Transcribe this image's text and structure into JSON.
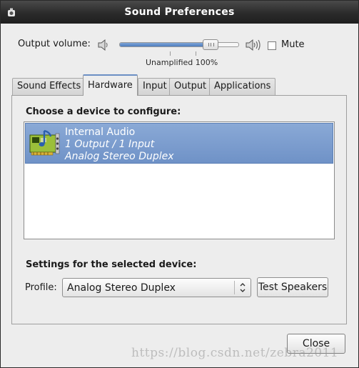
{
  "window": {
    "title": "Sound Preferences"
  },
  "volume": {
    "label": "Output volume:",
    "level_fraction": 0.77,
    "marker_label": "Unamplified 100%",
    "mute_label": "Mute",
    "mute_checked": false
  },
  "tabs": [
    {
      "label": "Sound Effects",
      "active": false
    },
    {
      "label": "Hardware",
      "active": true
    },
    {
      "label": "Input",
      "active": false
    },
    {
      "label": "Output",
      "active": false
    },
    {
      "label": "Applications",
      "active": false
    }
  ],
  "hardware": {
    "choose_label": "Choose a device to configure:",
    "devices": [
      {
        "name": "Internal Audio",
        "io": "1 Output / 1 Input",
        "profile": "Analog Stereo Duplex",
        "selected": true
      }
    ],
    "settings_label": "Settings for the selected device:",
    "profile_label": "Profile:",
    "profile_value": "Analog Stereo Duplex",
    "test_button": "Test Speakers"
  },
  "footer": {
    "close_button": "Close"
  },
  "watermark": "https://blog.csdn.net/zebra2011",
  "colors": {
    "selection": "#7b9bcc",
    "titlebar": "#2b2b2b",
    "slider_fill": "#5f8ccb"
  }
}
